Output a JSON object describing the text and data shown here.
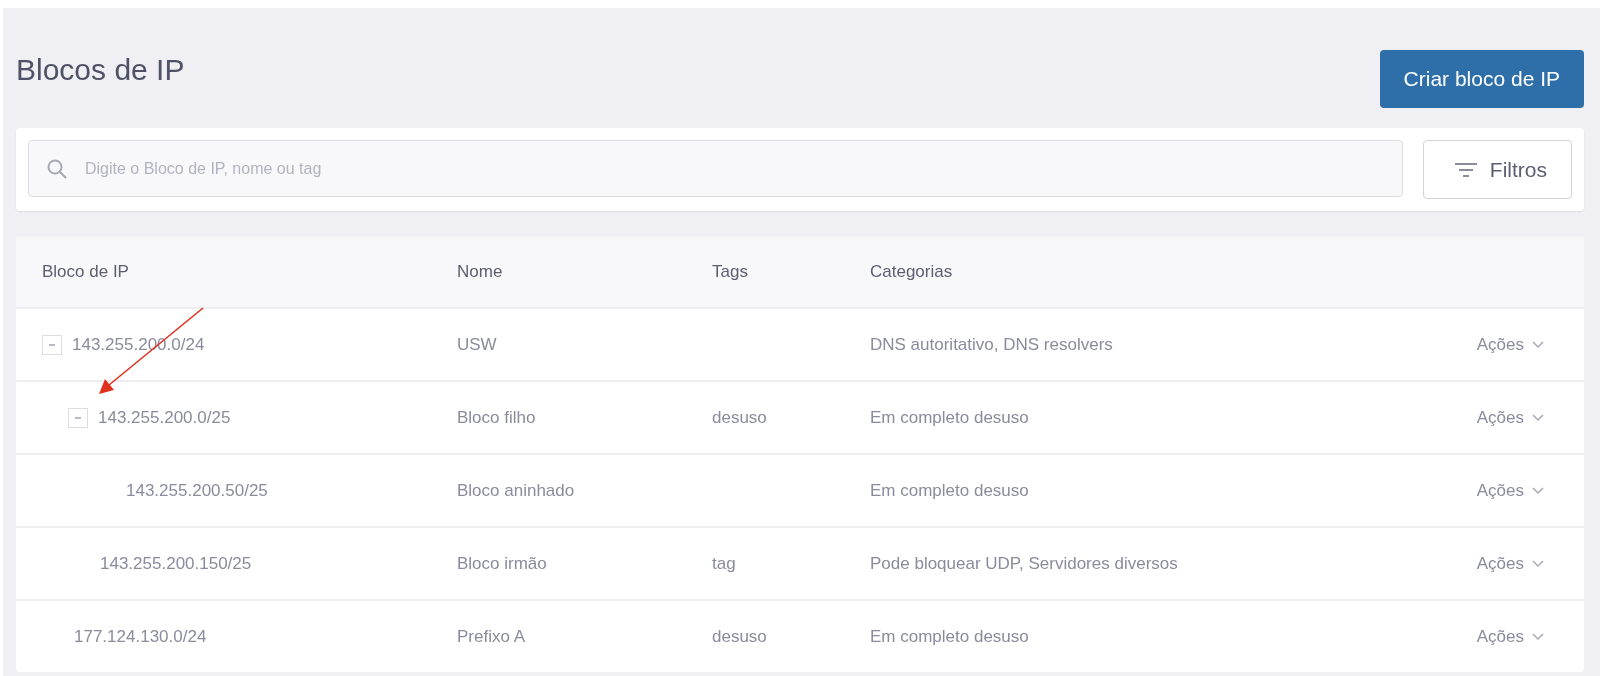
{
  "page": {
    "title": "Blocos de IP",
    "create_button": "Criar bloco de IP"
  },
  "search": {
    "placeholder": "Digite o Bloco de IP, nome ou tag"
  },
  "filters_button": "Filtros",
  "table": {
    "columns": [
      "Bloco de IP",
      "Nome",
      "Tags",
      "Categorias"
    ],
    "rows": [
      {
        "block": "143.255.200.0/24",
        "name": "USW",
        "categories": "DNS autoritativo, DNS resolvers",
        "action": "Ações",
        "expanded": true,
        "children": [
          {
            "block": "143.255.200.0/25",
            "name": "Bloco filho",
            "tags": "desuso",
            "categories": "Em completo desuso",
            "action": "Ações",
            "expanded": true,
            "children": [
              {
                "block": "143.255.200.50/25",
                "name": "Bloco aninhado",
                "categories": "Em completo desuso",
                "action": "Ações"
              }
            ]
          },
          {
            "block": "143.255.200.150/25",
            "name": "Bloco irmão",
            "tags": "tag",
            "categories": "Pode bloquear UDP, Servidores diversos",
            "action": "Ações"
          }
        ]
      },
      {
        "block": "177.124.130.0/24",
        "name": "Prefixo A",
        "tags": "desuso",
        "categories": "Em completo desuso",
        "action": "Ações"
      }
    ]
  }
}
